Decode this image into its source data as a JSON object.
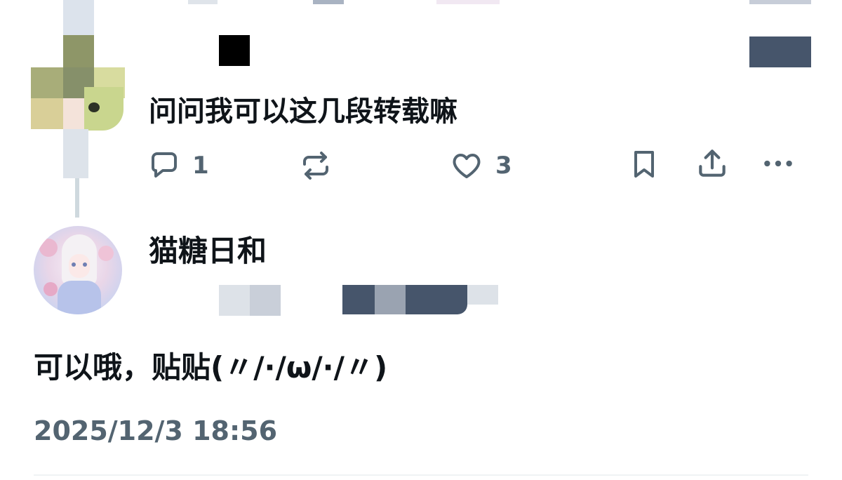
{
  "reply": {
    "text": "问问我可以这几段转载嘛",
    "actions": {
      "reply_count": "1",
      "like_count": "3"
    },
    "icons": [
      "reply-icon",
      "retweet-icon",
      "like-icon",
      "bookmark-icon",
      "share-icon",
      "more-icon"
    ]
  },
  "author": {
    "display_name": "猫糖日和"
  },
  "post": {
    "text": "可以哦，贴贴(〃/·/ω/·/〃)",
    "timestamp": "2025/12/3 18:56"
  },
  "colors": {
    "text": "#0f1419",
    "muted": "#536471",
    "thread_line": "#cfd9de",
    "redaction_dark": "#46556b",
    "redaction_light": "#d9dee6"
  }
}
